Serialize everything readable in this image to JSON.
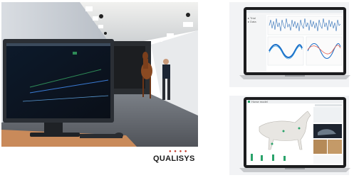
{
  "brand": {
    "logo_text": "QUALISYS",
    "logo_dots": "● ● ● ●",
    "accent_color": "#c0392b"
  },
  "photo": {
    "description_tag": "horse-gait-lab-photo"
  },
  "laptop_top": {
    "app": "analysis-software",
    "chart_colors": [
      "#1e6fc7",
      "#2f9be0",
      "#e45b4b"
    ]
  },
  "laptop_bottom": {
    "app": "horse-model-viewer",
    "model_color": "#e8e6e2"
  }
}
